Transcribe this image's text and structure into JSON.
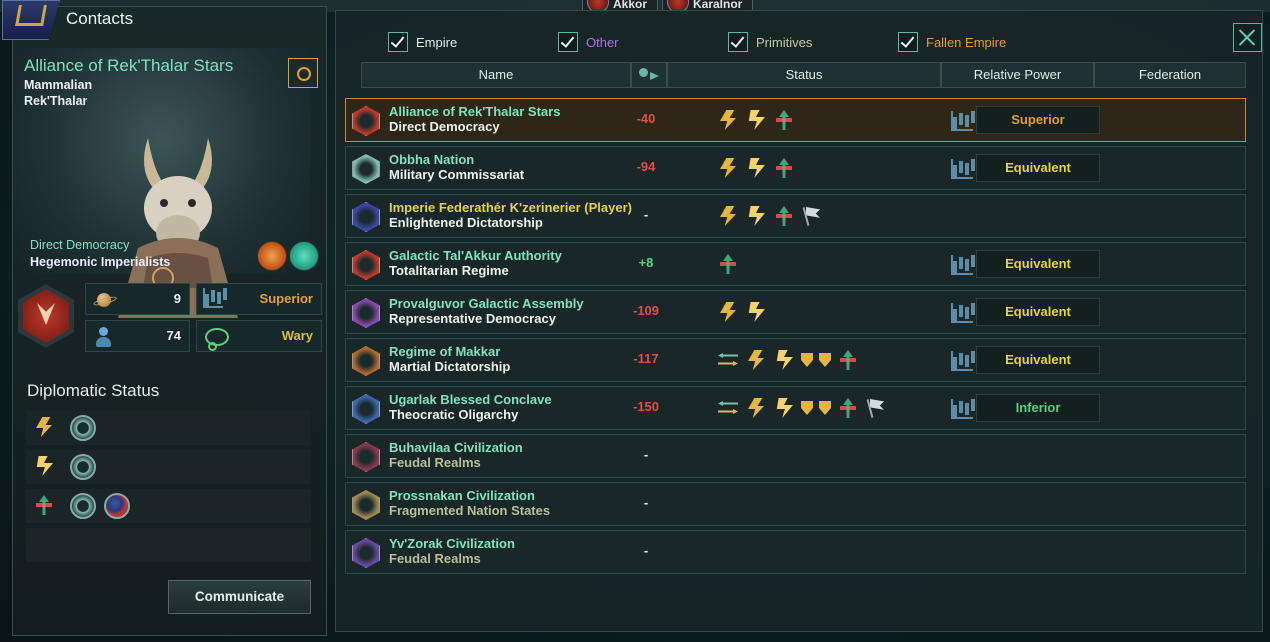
{
  "top_bar": {
    "chip1": "Akkor",
    "chip2": "Karalnor"
  },
  "left_panel": {
    "title": "Contacts",
    "empire_name": "Alliance of Rek'Thalar Stars",
    "species_class": "Mammalian",
    "species_name": "Rek'Thalar",
    "government": "Direct Democracy",
    "ethics": "Hegemonic Imperialists",
    "stats": {
      "planets": "9",
      "pops": "74",
      "relative_power": "Superior",
      "attitude": "Wary"
    },
    "diplomatic_status_title": "Diplomatic Status",
    "communicate_label": "Communicate"
  },
  "filters": {
    "empire": "Empire",
    "other": "Other",
    "primitives": "Primitives",
    "fallen_empire": "Fallen Empire"
  },
  "table": {
    "headers": {
      "name": "Name",
      "status": "Status",
      "relative_power": "Relative Power",
      "federation": "Federation"
    },
    "rows": [
      {
        "name": "Alliance of Rek'Thalar Stars",
        "gov": "Direct Democracy",
        "opinion": "-40",
        "power": "Superior",
        "icons": [
          "bolt",
          "bolt2",
          "xc"
        ],
        "emblem": "#c0392b",
        "name_color": "#7fe3c0",
        "opinion_color": "#e05040",
        "power_color": "#e0a030",
        "selected": true
      },
      {
        "name": "Obbha Nation",
        "gov": "Military Commissariat",
        "opinion": "-94",
        "power": "Equivalent",
        "icons": [
          "bolt",
          "bolt2",
          "xc"
        ],
        "emblem": "#7fbcb0",
        "name_color": "#7fe3c0",
        "opinion_color": "#e05040",
        "power_color": "#e6d23a"
      },
      {
        "name": "Imperie Federathér K'zerinerier (Player)",
        "gov": "Enlightened Dictatorship",
        "opinion": "-",
        "power": "",
        "icons": [
          "bolt",
          "bolt2",
          "xc",
          "flag"
        ],
        "emblem": "#3a4aa8",
        "name_color": "#e6d23a",
        "opinion_color": "#e8eeec",
        "power_color": "#e6d23a"
      },
      {
        "name": "Galactic Tal'Akkur Authority",
        "gov": "Totalitarian Regime",
        "opinion": "+8",
        "power": "Equivalent",
        "icons": [
          "xc"
        ],
        "emblem": "#c0392b",
        "name_color": "#7fe3c0",
        "opinion_color": "#5ad07a",
        "power_color": "#e6d23a"
      },
      {
        "name": "Provalguvor Galactic Assembly",
        "gov": "Representative Democracy",
        "opinion": "-109",
        "power": "Equivalent",
        "icons": [
          "bolt",
          "bolt2"
        ],
        "emblem": "#8a4ab0",
        "name_color": "#7fe3c0",
        "opinion_color": "#e05040",
        "power_color": "#e6d23a"
      },
      {
        "name": "Regime of Makkar",
        "gov": "Martial Dictatorship",
        "opinion": "-117",
        "power": "Equivalent",
        "icons": [
          "arrows",
          "bolt",
          "bolt2",
          "shield",
          "shield",
          "xc"
        ],
        "emblem": "#b06a30",
        "name_color": "#7fe3c0",
        "opinion_color": "#e05040",
        "power_color": "#e6d23a"
      },
      {
        "name": "Ugarlak Blessed Conclave",
        "gov": "Theocratic Oligarchy",
        "opinion": "-150",
        "power": "Inferior",
        "icons": [
          "arrows",
          "bolt",
          "bolt2",
          "shield",
          "shield",
          "xc",
          "flag"
        ],
        "emblem": "#3a6ab0",
        "name_color": "#7fe3c0",
        "opinion_color": "#e05040",
        "power_color": "#5ad07a"
      },
      {
        "name": "Buhavilaa Civilization",
        "gov": "Feudal Realms",
        "opinion": "-",
        "power": "",
        "icons": [],
        "emblem": "#8a3a4a",
        "name_color": "#7fe3c0",
        "opinion_color": "#e8eeec",
        "power_color": "#e6d23a",
        "gov_dim": true
      },
      {
        "name": "Prossnakan Civilization",
        "gov": "Fragmented Nation States",
        "opinion": "-",
        "power": "",
        "icons": [],
        "emblem": "#a08a50",
        "name_color": "#7fe3c0",
        "opinion_color": "#e8eeec",
        "power_color": "#e6d23a",
        "gov_dim": true
      },
      {
        "name": "Yv'Zorak Civilization",
        "gov": "Feudal Realms",
        "opinion": "-",
        "power": "",
        "icons": [],
        "emblem": "#6a4aa8",
        "name_color": "#7fe3c0",
        "opinion_color": "#e8eeec",
        "power_color": "#e6d23a",
        "gov_dim": true
      }
    ]
  }
}
